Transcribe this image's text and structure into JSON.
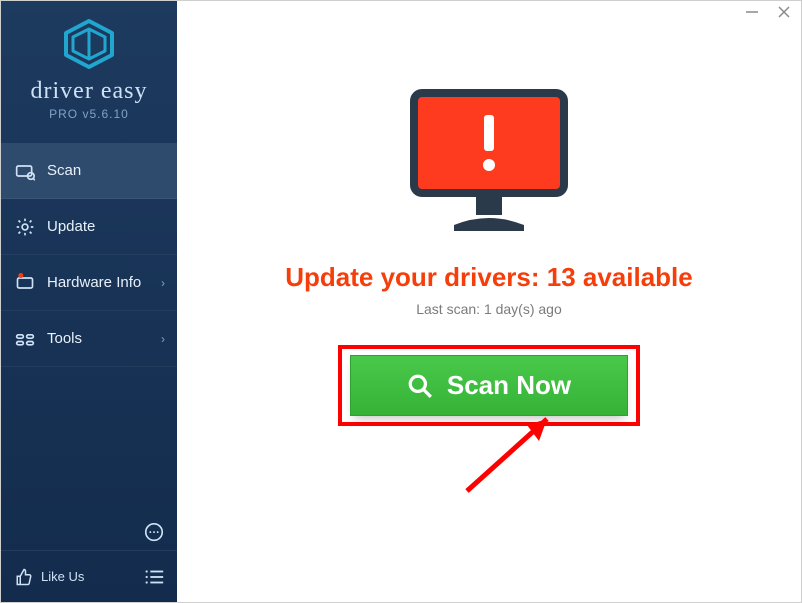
{
  "brand": {
    "name": "driver easy",
    "version": "PRO v5.6.10"
  },
  "sidebar": {
    "items": [
      {
        "label": "Scan",
        "icon": "scan",
        "active": true,
        "chevron": false
      },
      {
        "label": "Update",
        "icon": "update",
        "active": false,
        "chevron": false
      },
      {
        "label": "Hardware Info",
        "icon": "hardware",
        "active": false,
        "chevron": true
      },
      {
        "label": "Tools",
        "icon": "tools",
        "active": false,
        "chevron": true
      }
    ],
    "like_us": "Like Us"
  },
  "main": {
    "headline": "Update your drivers: 13 available",
    "subline": "Last scan: 1 day(s) ago",
    "scan_button": "Scan Now"
  }
}
